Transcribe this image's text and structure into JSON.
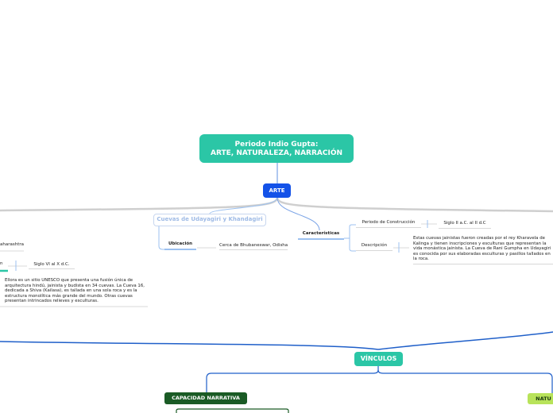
{
  "title": {
    "line1": "Periodo Indio Gupta:",
    "line2": "ARTE, NATURALEZA, NARRACIÓN"
  },
  "arte": "ARTE",
  "vinculos": "VÍNCULOS",
  "capacidad": "CAPACIDAD NARRATIVA",
  "naturaleza": "NATU",
  "cuevas": {
    "title": "Cuevas de Udayagiri y Khandagiri",
    "ubicacion_label": "Ubicación",
    "ubicacion_value": "Cerca de Bhubaneswar, Odisha",
    "caracteristicas_label": "Características",
    "periodo_label": "Periodo de Construcción",
    "periodo_value": "Siglo II a.C. al II d.C",
    "descripcion_label": "Descripción",
    "descripcion_text": "Estas cuevas jainistas fueron creadas por el rey Kharavela de Kalinga y tienen inscripciones y esculturas que representan la vida monástica jainista. La Cueva de Rani Gumpha en Udayagiri es conocida por sus elaboradas esculturas y pasillos tallados en la roca."
  },
  "ellora": {
    "location_fragment": "aharashtra",
    "period_label_fragment": "n",
    "period_value": "Siglo VI al X d.C.",
    "description": "Ellora es un sitio UNESCO que presenta una fusión única de arquitectura hindú, jainista y budista en 34 cuevas. La Cueva 16, dedicada a Shiva (Kailasa), es tallada en una sola roca y es la estructura monolítica más grande del mundo. Otras cuevas presentan intrincados relieves y esculturas."
  },
  "colors": {
    "root": "#2bc6a6",
    "arte": "#1452e8",
    "capacidad": "#1a5b25",
    "naturaleza": "#b8e35a",
    "connector_blue": "#1f5fc9",
    "connector_gray": "#cfcfcf"
  }
}
